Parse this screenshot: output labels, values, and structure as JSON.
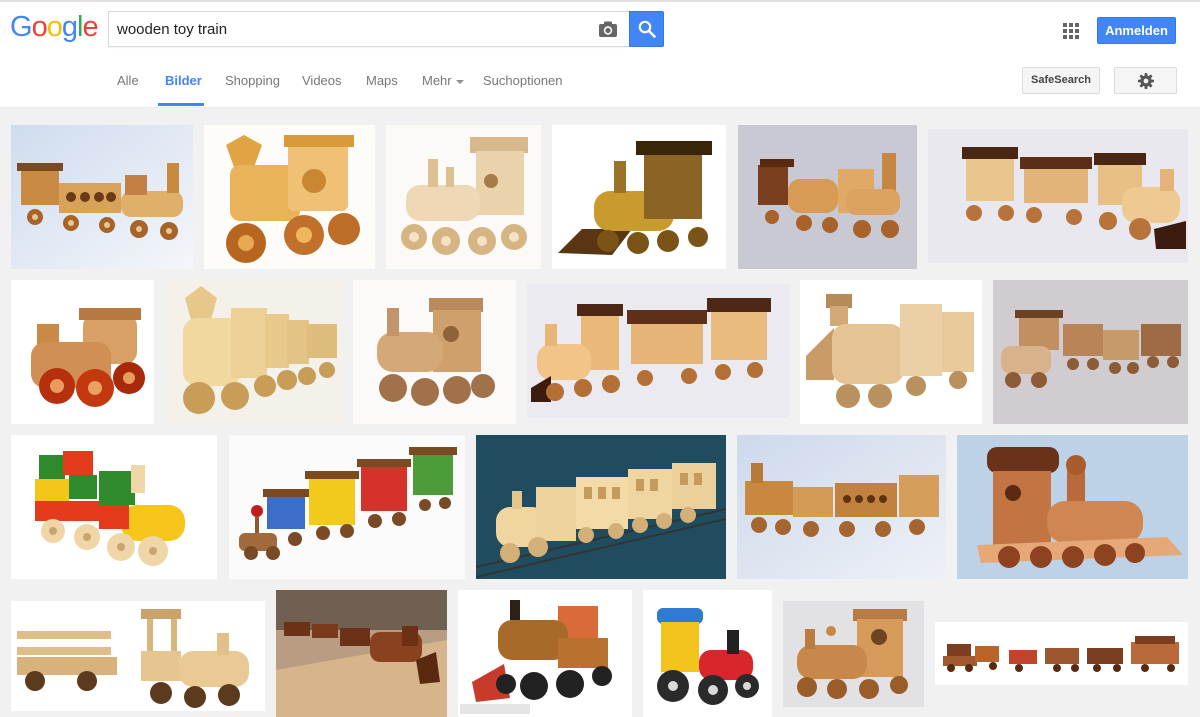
{
  "header": {
    "logo_letters": [
      {
        "ch": "G",
        "color": "#4285f4"
      },
      {
        "ch": "o",
        "color": "#ea4335"
      },
      {
        "ch": "o",
        "color": "#fbbc05"
      },
      {
        "ch": "g",
        "color": "#4285f4"
      },
      {
        "ch": "l",
        "color": "#34a853"
      },
      {
        "ch": "e",
        "color": "#ea4335"
      }
    ],
    "search_value": "wooden toy train",
    "signin_label": "Anmelden",
    "icons": [
      "camera-icon",
      "search-icon",
      "apps-grid-icon"
    ]
  },
  "nav": {
    "tabs": [
      {
        "label": "Alle"
      },
      {
        "label": "Bilder"
      },
      {
        "label": "Shopping"
      },
      {
        "label": "Videos"
      },
      {
        "label": "Maps"
      },
      {
        "label": "Mehr"
      },
      {
        "label": "Suchoptionen"
      }
    ],
    "active_tab": "Bilder",
    "safesearch_label": "SafeSearch",
    "settings_icon": "gear-icon"
  },
  "colors": {
    "accent": "#4285f4",
    "results_bg": "#f1f1f1"
  }
}
